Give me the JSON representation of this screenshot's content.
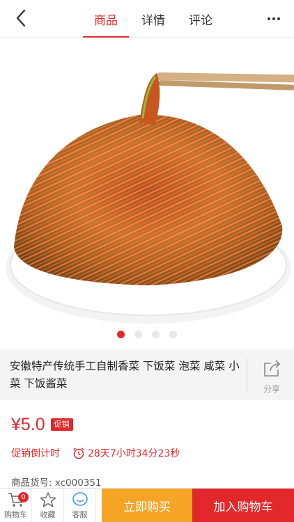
{
  "header": {
    "tabs": [
      {
        "label": "商品",
        "active": true
      },
      {
        "label": "详情",
        "active": false
      },
      {
        "label": "评论",
        "active": false
      }
    ],
    "back_icon": "chevron-left-icon",
    "more_icon": "more-dots-icon"
  },
  "gallery": {
    "image_subject": "pickled cabbage dish with chopsticks",
    "dots_total": 4,
    "active_index": 0
  },
  "product": {
    "title": "安徽特产传统手工自制香菜 下饭菜 泡菜 咸菜 小菜 下饭酱菜",
    "share_label": "分享",
    "price": "¥5.0",
    "promo_tag": "促销",
    "countdown_label": "促销倒计时",
    "countdown_value": "28天7小时34分23秒",
    "sku": "商品货号:  xc000351"
  },
  "bottom": {
    "cart_label": "购物车",
    "cart_count": "0",
    "fav_label": "收藏",
    "service_label": "客服",
    "buy_now": "立即购买",
    "add_cart": "加入购物车"
  },
  "colors": {
    "accent": "#e2282a",
    "buy_button": "#f6a425"
  }
}
